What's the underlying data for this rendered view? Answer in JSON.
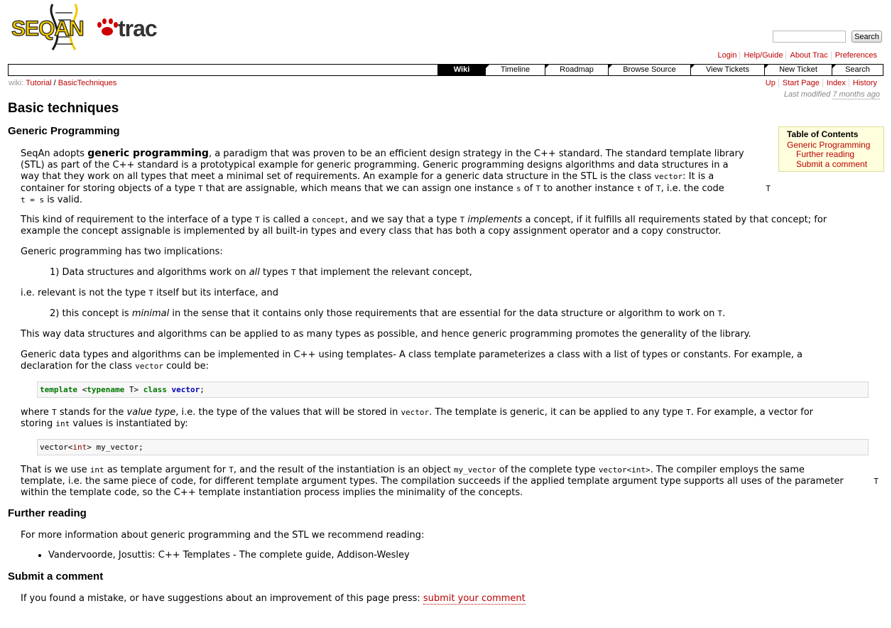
{
  "header": {
    "logo_text": "SEQAN trac",
    "search_button": "Search",
    "search_value": ""
  },
  "metanav": [
    "Login",
    "Help/Guide",
    "About Trac",
    "Preferences"
  ],
  "mainnav": [
    {
      "label": "Wiki",
      "active": true
    },
    {
      "label": "Timeline",
      "active": false
    },
    {
      "label": "Roadmap",
      "active": false
    },
    {
      "label": "Browse Source",
      "active": false
    },
    {
      "label": "View Tickets",
      "active": false
    },
    {
      "label": "New Ticket",
      "active": false
    },
    {
      "label": "Search",
      "active": false
    }
  ],
  "ctxnav": {
    "breadcrumb_prefix": "wiki:",
    "crumb1": "Tutorial",
    "sep": "/",
    "crumb2": "BasicTechniques",
    "links": [
      "Up",
      "Start Page",
      "Index",
      "History"
    ],
    "last_modified_prefix": "Last modified",
    "last_modified_age": "7 months ago"
  },
  "page": {
    "title": "Basic techniques",
    "h_generic": "Generic Programming",
    "h_further": "Further reading",
    "h_submit": "Submit a comment"
  },
  "toc": {
    "title": "Table of Contents",
    "items": [
      "Generic Programming",
      "Further reading",
      "Submit a comment"
    ]
  },
  "text": {
    "p1_a": "SeqAn adopts ",
    "p1_b": "generic programming",
    "p1_c": ", a paradigm that was proven to be an efficient design strategy in the C++ standard. The standard template library",
    "p1_d": "(STL) as part of the C++ standard is a prototypical example for generic programming. Generic programming designs algorithms and data structures in a",
    "p1_e": "way that they work on all types that meet a minimal set of requirements. An example for a generic data structure in the STL is the class ",
    "p1_f": "vector",
    "p1_g": ": It is a",
    "p1_h": "container for storing objects of a type ",
    "p1_i": "T",
    "p1_j": " that are assignable, which means that we can assign one instance ",
    "p1_k": "s",
    "p1_l": " of ",
    "p1_m": "T",
    "p1_n": " to another instance ",
    "p1_o": "t",
    "p1_p": " of ",
    "p1_q": "T",
    "p1_r": ", i.e. the code ",
    "p1_s": "T",
    "p1_t": "t = s",
    "p1_u": " is valid.",
    "p2_a": "This kind of requirement to the interface of a type ",
    "p2_b": "T",
    "p2_c": " is called a ",
    "p2_d": "concept",
    "p2_e": ", and we say that a type ",
    "p2_f": "T",
    "p2_g": " ",
    "p2_h": "implements",
    "p2_i": " a concept, if it fulfills all requirements stated by that concept; for",
    "p2_j": "example the concept assignable is implemented by all built-in types and every class that has both a copy assignment operator and a copy constructor.",
    "p3": "Generic programming has two implications:",
    "p4_a": "1) Data structures and algorithms work on ",
    "p4_b": "all",
    "p4_c": " types ",
    "p4_d": "T",
    "p4_e": " that implement the relevant concept,",
    "p5_a": "i.e. relevant is not the type ",
    "p5_b": "T",
    "p5_c": " itself but its interface, and",
    "p6_a": "2) this concept is ",
    "p6_b": "minimal",
    "p6_c": " in the sense that it contains only those requirements that are essential for the data structure or algorithm to work on ",
    "p6_d": "T",
    "p6_e": ".",
    "p7": "This way data structures and algorithms can be applied to as many types as possible, and hence generic programming promotes the generality of the library.",
    "p8_a": "Generic data types and algorithms can be implemented in C++ using templates- A class template parameterizes a class with a list of types or constants. For example, a",
    "p8_b": "declaration for the class ",
    "p8_c": "vector",
    "p8_d": " could be:",
    "code1_a": "template",
    "code1_b": " <",
    "code1_c": "typename",
    "code1_d": " T> ",
    "code1_e": "class",
    "code1_f": " ",
    "code1_g": "vector",
    "code1_h": ";",
    "p9_a": "where ",
    "p9_b": "T",
    "p9_c": " stands for the ",
    "p9_d": "value type",
    "p9_e": ", i.e. the type of the values that will be stored in ",
    "p9_f": "vector",
    "p9_g": ". The template is generic, it can be applied to any type ",
    "p9_h": "T",
    "p9_i": ". For example, a vector for",
    "p9_j": "storing ",
    "p9_k": "int",
    "p9_l": " values is instantiated by:",
    "code2_a": "vector<",
    "code2_b": "int",
    "code2_c": "> my_vector;",
    "p10_a": "That is we use ",
    "p10_b": "int",
    "p10_c": " as template argument for ",
    "p10_d": "T",
    "p10_e": ", and the result of the instantiation is an object ",
    "p10_f": "my_vector",
    "p10_g": " of the complete type ",
    "p10_h": "vector<int>",
    "p10_i": ". The compiler employs the same",
    "p10_j": "template, i.e. the same piece of code, for different template argument types. The compilation succeeds if the applied template argument type supports all uses of the parameter ",
    "p10_k": "T",
    "p10_l": "within the template code, so the C++ template instantiation process implies the minimality of the concepts.",
    "p11": "For more information about generic programming and the STL we recommend reading:",
    "li1": "Vandervoorde, Josuttis: C++ Templates - The complete guide, Addison-Wesley",
    "p12_a": "If you found a mistake, or have suggestions about an improvement of this page press: ",
    "p12_b": "submit your comment"
  }
}
